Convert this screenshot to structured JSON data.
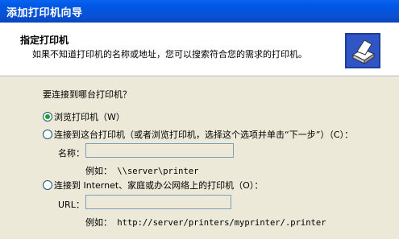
{
  "window": {
    "title": "添加打印机向导"
  },
  "header": {
    "title": "指定打印机",
    "subtitle": "如果不知道打印机的名称或地址，您可以搜索符合您的需求的打印机。",
    "icon": "printer-icon"
  },
  "question": "要连接到哪台打印机？",
  "options": [
    {
      "label": "浏览打印机（W）",
      "checked": true
    },
    {
      "label": "连接到这台打印机（或者浏览打印机，选择这个选项并单击“下一步”）（C）：",
      "checked": false
    },
    {
      "label": "连接到 Internet、家庭或办公网络上的打印机（O）：",
      "checked": false
    }
  ],
  "name_field": {
    "label": "名称：",
    "value": ""
  },
  "name_example": {
    "label": "例如：",
    "value": "\\\\server\\printer"
  },
  "url_field": {
    "label": "URL：",
    "value": ""
  },
  "url_example": {
    "label": "例如：",
    "value": "http://server/printers/myprinter/.printer"
  },
  "colors": {
    "titlebar": "#0a4fd0",
    "dialog_bg": "#ece9d8",
    "radio_dot": "#21a121"
  }
}
